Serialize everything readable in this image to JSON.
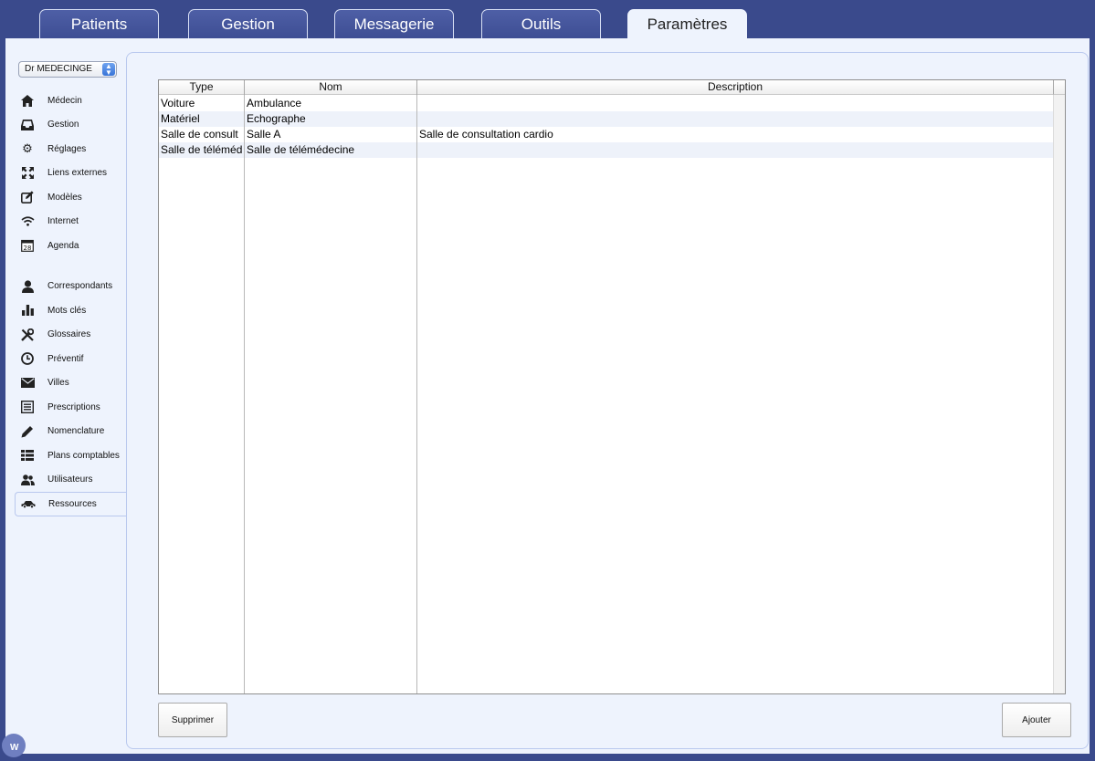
{
  "tabs": [
    {
      "label": "Patients",
      "active": false
    },
    {
      "label": "Gestion",
      "active": false
    },
    {
      "label": "Messagerie",
      "active": false
    },
    {
      "label": "Outils",
      "active": false
    },
    {
      "label": "Paramètres",
      "active": true
    }
  ],
  "user_select": {
    "value": "Dr MEDECINGE"
  },
  "sidebar": {
    "group1": [
      {
        "label": "Médecin",
        "icon": "home-icon"
      },
      {
        "label": "Gestion",
        "icon": "inbox-icon"
      },
      {
        "label": "Réglages",
        "icon": "gear-icon"
      },
      {
        "label": "Liens externes",
        "icon": "expand-icon"
      },
      {
        "label": "Modèles",
        "icon": "edit-icon"
      },
      {
        "label": "Internet",
        "icon": "wifi-icon"
      },
      {
        "label": "Agenda",
        "icon": "calendar-icon",
        "badge": "28"
      }
    ],
    "group2": [
      {
        "label": "Correspondants",
        "icon": "person-icon"
      },
      {
        "label": "Mots clés",
        "icon": "bar-chart-icon"
      },
      {
        "label": "Glossaires",
        "icon": "tools-icon"
      },
      {
        "label": "Préventif",
        "icon": "clock-icon"
      },
      {
        "label": "Villes",
        "icon": "envelope-icon"
      },
      {
        "label": "Prescriptions",
        "icon": "list-icon"
      },
      {
        "label": "Nomenclature",
        "icon": "pencil-icon"
      },
      {
        "label": "Plans comptables",
        "icon": "table-list-icon"
      },
      {
        "label": "Utilisateurs",
        "icon": "users-icon"
      },
      {
        "label": "Ressources",
        "icon": "car-icon",
        "selected": true
      }
    ]
  },
  "table": {
    "columns": [
      "Type",
      "Nom",
      "Description"
    ],
    "rows": [
      {
        "type": "Voiture",
        "nom": "Ambulance",
        "description": ""
      },
      {
        "type": "Matériel",
        "nom": "Echographe",
        "description": ""
      },
      {
        "type": "Salle de consult",
        "nom": "Salle A",
        "description": "Salle de consultation cardio"
      },
      {
        "type": "Salle de téléméd",
        "nom": "Salle de télémédecine",
        "description": ""
      }
    ]
  },
  "buttons": {
    "delete": "Supprimer",
    "add": "Ajouter"
  },
  "badge": {
    "letter": "W"
  }
}
